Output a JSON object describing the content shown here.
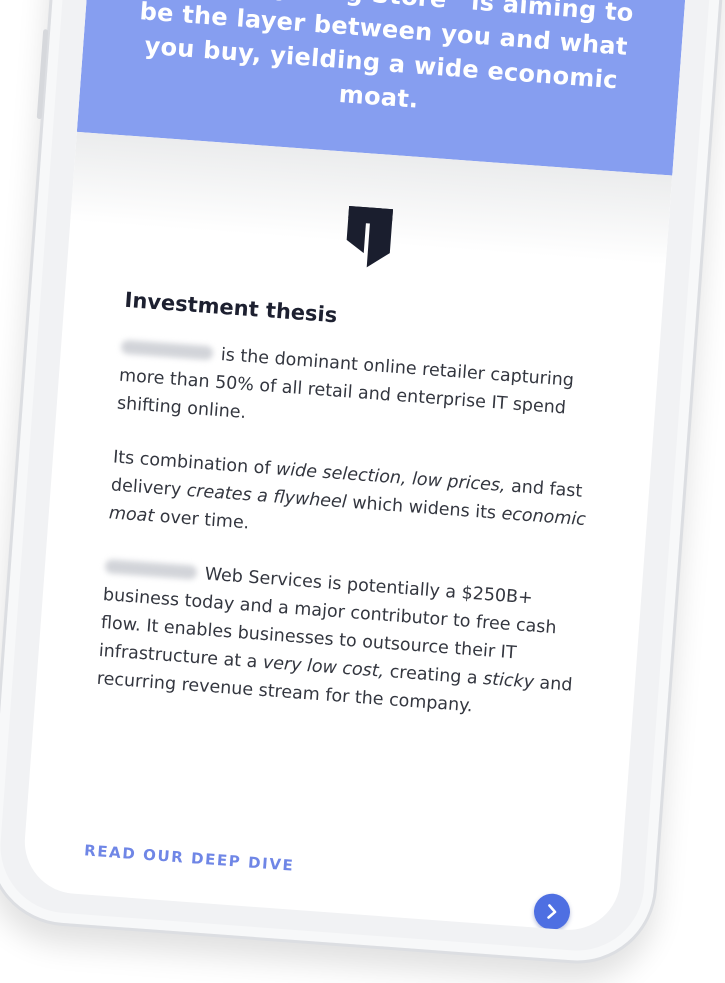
{
  "banner": {
    "text": "“The Everything Store” is aiming to be the layer between you and what you buy, yielding a wide economic moat.",
    "color": "#869ef0"
  },
  "brand": {
    "logo_icon": "shield-t-icon",
    "logo_color": "#1a1e2e"
  },
  "thesis": {
    "heading": "Investment thesis",
    "para1": "is the dominant online retailer capturing more than 50% of all retail and enterprise IT spend shifting online.",
    "para2": {
      "p1": "Its combination of ",
      "em1": "wide selection, low prices,",
      "p2": " and fast delivery ",
      "em2": "creates a flywheel",
      "p3": " which widens its ",
      "em3": "economic moat",
      "p4": " over time."
    },
    "para3": {
      "p1": "Web Services is potentially a $250B+ business today and a major contributor to free cash flow. It enables businesses to outsource their IT infrastructure at a ",
      "em1": "very low cost,",
      "p2": " creating a ",
      "em2": "sticky",
      "p3": " and recurring revenue stream for the company."
    }
  },
  "cta": {
    "label": "READ OUR DEEP DIVE",
    "button_icon": "chevron-right-icon",
    "accent": "#4e6fe2"
  }
}
